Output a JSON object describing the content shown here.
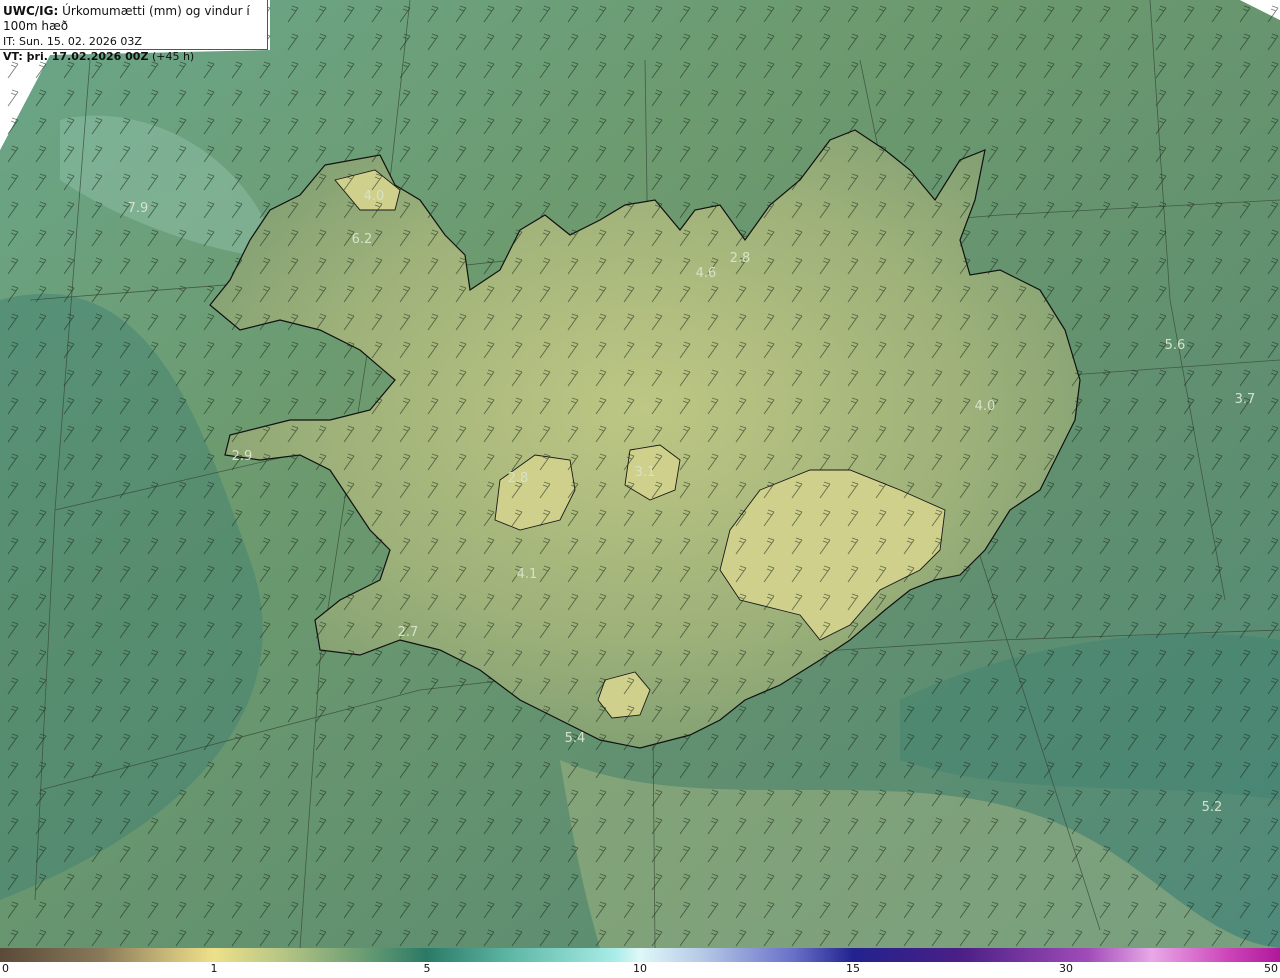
{
  "header": {
    "model": "UWC/IG:",
    "description": "Úrkomumætti (mm) og vindur í 100m hæð",
    "initial_time": "IT: Sun. 15. 02. 2026 03Z",
    "valid_time_bold": "VT: þri. 17.02.2026 00Z",
    "valid_time_offset": "(+45 h)"
  },
  "map": {
    "region": "Iceland",
    "field": "precipitable water",
    "value_labels": [
      "4.0",
      "6.2",
      "7.9",
      "4.6",
      "2.8",
      "5.6",
      "3.7",
      "4.0",
      "2.9",
      "2.8",
      "3.1",
      "4.1",
      "2.7",
      "5.4",
      "5.2"
    ]
  },
  "colorbar": {
    "ticks": [
      "0",
      "1",
      "5",
      "10",
      "15",
      "30",
      "50"
    ]
  },
  "colors": {
    "ocean": "#5f8f6a",
    "land_high": "#c8c985",
    "coast": "#111111"
  }
}
